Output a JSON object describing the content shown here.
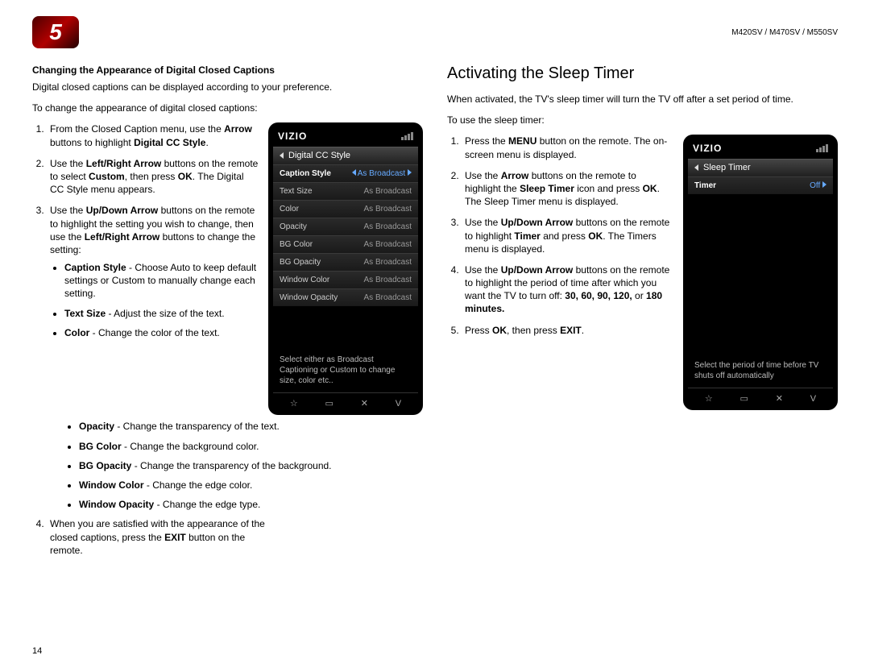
{
  "header": {
    "chapter": "5",
    "models": "M420SV / M470SV / M550SV"
  },
  "left": {
    "heading": "Changing the Appearance of Digital Closed Captions",
    "intro1": "Digital closed captions can be displayed according to your preference.",
    "intro2": "To change the appearance of digital closed captions:",
    "step1a": "From the Closed Caption menu, use the ",
    "step1b": "Arrow",
    "step1c": " buttons to highlight ",
    "step1d": "Digital CC Style",
    "step1e": ".",
    "step2a": "Use the ",
    "step2b": "Left/Right Arrow",
    "step2c": " buttons on the remote to select ",
    "step2d": "Custom",
    "step2e": ", then press ",
    "step2f": "OK",
    "step2g": ". The Digital CC Style menu appears.",
    "step3a": "Use the ",
    "step3b": "Up/Down Arrow",
    "step3c": " buttons on the remote to highlight the setting you wish to change, then use the ",
    "step3d": "Left/Right Arrow",
    "step3e": " buttons to change the setting:",
    "opt1a": "Caption Style",
    "opt1b": " - Choose Auto to keep default settings or Custom to manually change each setting.",
    "opt2a": "Text Size",
    "opt2b": " - Adjust the size of the text.",
    "opt3a": "Color",
    "opt3b": " - Change the color of the text.",
    "opt4a": "Opacity",
    "opt4b": " - Change the transparency of the text.",
    "opt5a": "BG Color",
    "opt5b": " - Change the background color.",
    "opt6a": "BG Opacity",
    "opt6b": " - Change the transparency of the background.",
    "opt7a": "Window Color",
    "opt7b": " - Change the edge color.",
    "opt8a": "Window Opacity",
    "opt8b": " - Change the edge type.",
    "step4a": "When you are satisfied with the appearance of the closed captions, press the ",
    "step4b": "EXIT",
    "step4c": " button on the remote."
  },
  "right": {
    "heading": "Activating the Sleep Timer",
    "intro1": "When activated, the TV's sleep timer will turn the TV off after a set period of time.",
    "intro2": "To use the sleep timer:",
    "step1a": "Press the ",
    "step1b": "MENU",
    "step1c": " button on the remote. The on-screen menu is displayed.",
    "step2a": "Use the ",
    "step2b": "Arrow",
    "step2c": " buttons on the remote to highlight the ",
    "step2d": "Sleep Timer",
    "step2e": " icon and press ",
    "step2f": "OK",
    "step2g": ". The Sleep Timer menu is displayed.",
    "step3a": "Use the ",
    "step3b": "Up/Down Arrow",
    "step3c": " buttons on the remote to highlight ",
    "step3d": "Timer",
    "step3e": " and press ",
    "step3f": "OK",
    "step3g": ". The Timers menu is displayed.",
    "step4a": "Use the ",
    "step4b": "Up/Down Arrow",
    "step4c": " buttons on the remote to highlight the period of time after which you want the TV to turn off: ",
    "step4d": "30, 60, 90, 120,",
    "step4e": " or ",
    "step4f": "180 minutes.",
    "step5a": "Press ",
    "step5b": "OK",
    "step5c": ", then press ",
    "step5d": "EXIT",
    "step5e": "."
  },
  "tv1": {
    "logo": "VIZIO",
    "crumb": "Digital CC Style",
    "rows": [
      {
        "lab": "Caption Style",
        "val": "As Broadcast"
      },
      {
        "lab": "Text Size",
        "val": "As Broadcast"
      },
      {
        "lab": "Color",
        "val": "As Broadcast"
      },
      {
        "lab": "Opacity",
        "val": "As Broadcast"
      },
      {
        "lab": "BG Color",
        "val": "As Broadcast"
      },
      {
        "lab": "BG Opacity",
        "val": "As Broadcast"
      },
      {
        "lab": "Window Color",
        "val": "As Broadcast"
      },
      {
        "lab": "Window Opacity",
        "val": "As Broadcast"
      }
    ],
    "hint": "Select either as Broadcast Captioning or Custom to change size, color etc.."
  },
  "tv2": {
    "logo": "VIZIO",
    "crumb": "Sleep Timer",
    "rows": [
      {
        "lab": "Timer",
        "val": "Off"
      }
    ],
    "hint": "Select the period of time before TV shuts off automatically"
  },
  "footer_icons": {
    "star": "☆",
    "rec": "▭",
    "x": "✕",
    "v": "V"
  },
  "page_num": "14"
}
